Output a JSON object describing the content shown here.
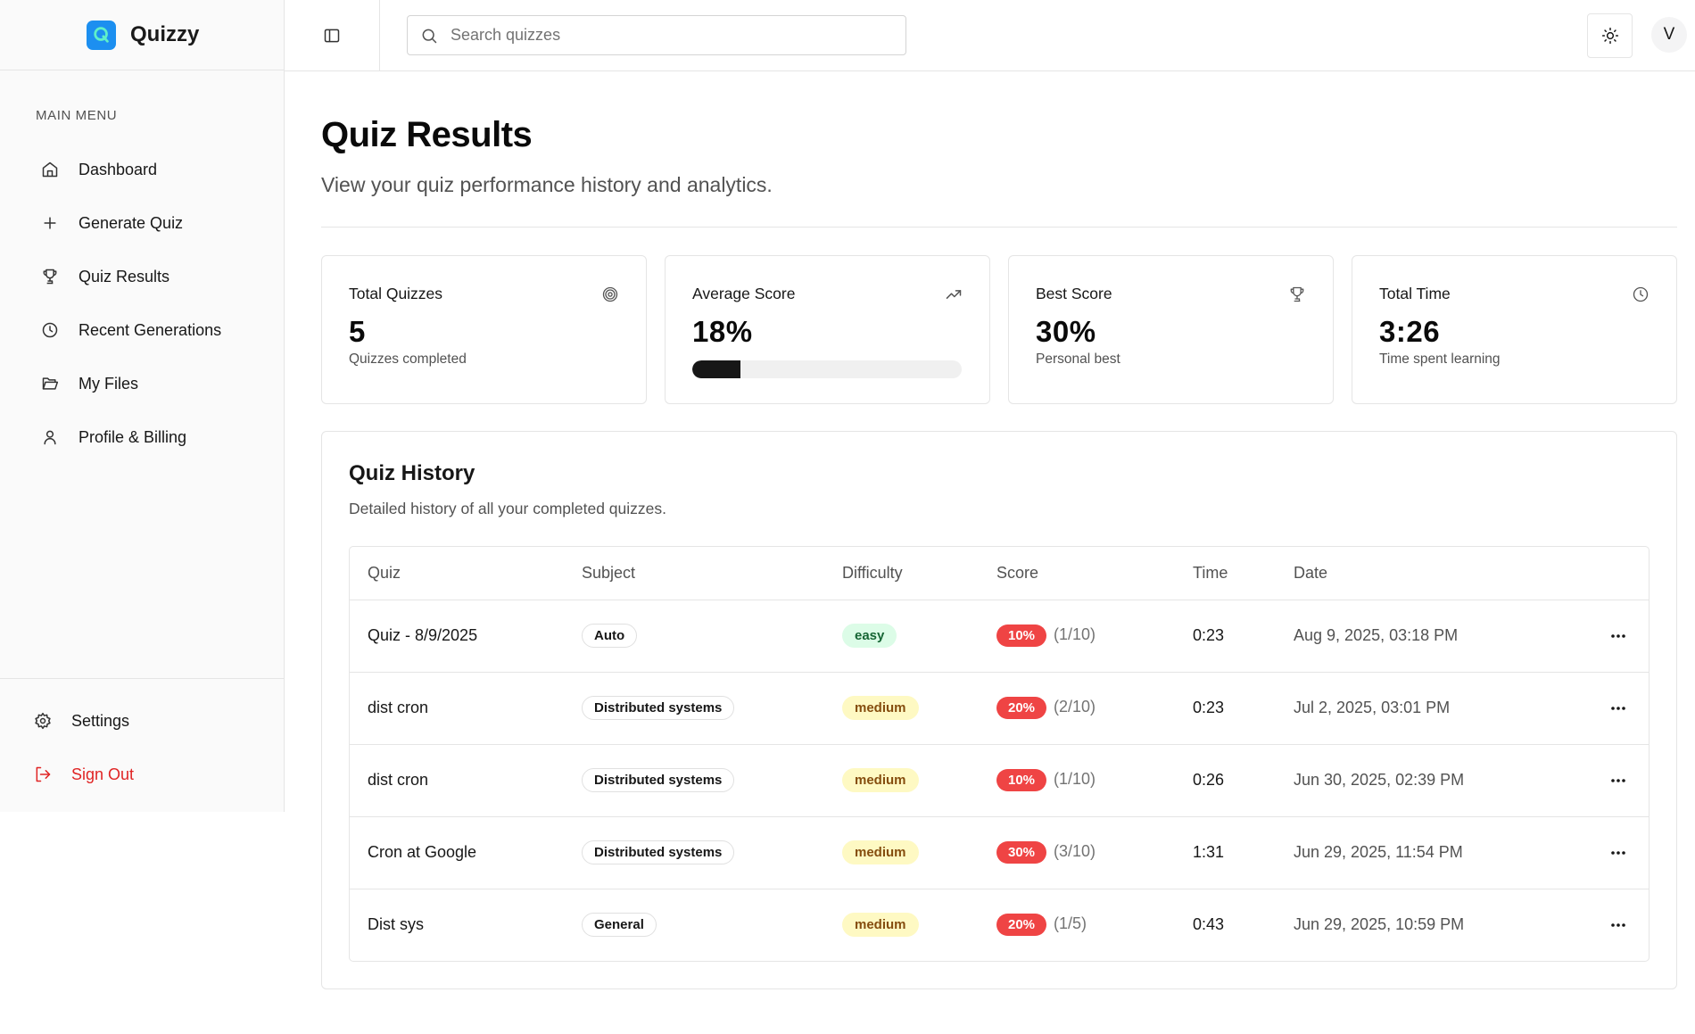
{
  "brand": {
    "name": "Quizzy"
  },
  "search": {
    "placeholder": "Search quizzes"
  },
  "user": {
    "initial": "V"
  },
  "sidebar": {
    "section_title": "MAIN MENU",
    "items": [
      {
        "label": "Dashboard",
        "icon": "home-icon"
      },
      {
        "label": "Generate Quiz",
        "icon": "plus-icon"
      },
      {
        "label": "Quiz Results",
        "icon": "trophy-icon"
      },
      {
        "label": "Recent Generations",
        "icon": "clock-icon"
      },
      {
        "label": "My Files",
        "icon": "folder-open-icon"
      },
      {
        "label": "Profile & Billing",
        "icon": "user-icon"
      }
    ],
    "settings_label": "Settings",
    "signout_label": "Sign Out"
  },
  "page": {
    "title": "Quiz Results",
    "subtitle": "View your quiz performance history and analytics."
  },
  "stats": {
    "total_quizzes": {
      "label": "Total Quizzes",
      "value": "5",
      "caption": "Quizzes completed",
      "icon": "target-icon"
    },
    "average_score": {
      "label": "Average Score",
      "value": "18%",
      "progress_percent": 18,
      "icon": "trending-up-icon"
    },
    "best_score": {
      "label": "Best Score",
      "value": "30%",
      "caption": "Personal best",
      "icon": "trophy-icon"
    },
    "total_time": {
      "label": "Total Time",
      "value": "3:26",
      "caption": "Time spent learning",
      "icon": "clock-icon"
    }
  },
  "history": {
    "title": "Quiz History",
    "subtitle": "Detailed history of all your completed quizzes.",
    "columns": [
      "Quiz",
      "Subject",
      "Difficulty",
      "Score",
      "Time",
      "Date"
    ],
    "rows": [
      {
        "quiz": "Quiz - 8/9/2025",
        "subject": "Auto",
        "difficulty": "easy",
        "score": "10%",
        "fraction": "(1/10)",
        "time": "0:23",
        "date": "Aug 9, 2025, 03:18 PM"
      },
      {
        "quiz": "dist cron",
        "subject": "Distributed systems",
        "difficulty": "medium",
        "score": "20%",
        "fraction": "(2/10)",
        "time": "0:23",
        "date": "Jul 2, 2025, 03:01 PM"
      },
      {
        "quiz": "dist cron",
        "subject": "Distributed systems",
        "difficulty": "medium",
        "score": "10%",
        "fraction": "(1/10)",
        "time": "0:26",
        "date": "Jun 30, 2025, 02:39 PM"
      },
      {
        "quiz": "Cron at Google",
        "subject": "Distributed systems",
        "difficulty": "medium",
        "score": "30%",
        "fraction": "(3/10)",
        "time": "1:31",
        "date": "Jun 29, 2025, 11:54 PM"
      },
      {
        "quiz": "Dist sys",
        "subject": "General",
        "difficulty": "medium",
        "score": "20%",
        "fraction": "(1/5)",
        "time": "0:43",
        "date": "Jun 29, 2025, 10:59 PM"
      }
    ]
  },
  "colors": {
    "brand": "#1c8ff0",
    "score_badge": "#ef4444",
    "easy_bg": "#dcfce7",
    "medium_bg": "#fef9c3",
    "signout": "#e02424"
  }
}
